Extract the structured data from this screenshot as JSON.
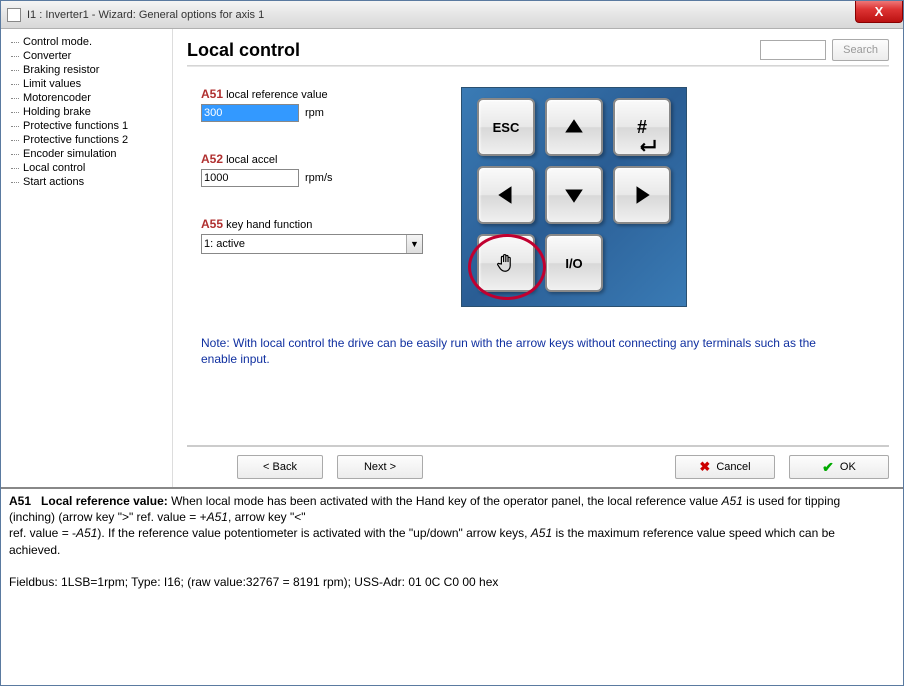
{
  "window": {
    "title": "I1 : Inverter1 - Wizard: General options for axis 1",
    "close": "X"
  },
  "sidebar": {
    "items": [
      "Control mode.",
      "Converter",
      "Braking resistor",
      "Limit values",
      "Motorencoder",
      "Holding brake",
      "Protective functions 1",
      "Protective functions 2",
      "Encoder simulation",
      "Local control",
      "Start actions"
    ]
  },
  "header": {
    "title": "Local control",
    "search_button": "Search"
  },
  "params": {
    "a51": {
      "code": "A51",
      "desc": "local reference value",
      "value": "300",
      "unit": "rpm"
    },
    "a52": {
      "code": "A52",
      "desc": "local accel",
      "value": "1000",
      "unit": "rpm/s"
    },
    "a55": {
      "code": "A55",
      "desc": "key hand function",
      "value": "1: active"
    }
  },
  "keypad": {
    "esc": "ESC",
    "hash": "#",
    "io": "I/O"
  },
  "note": "Note: With local control the drive can be easily run with the arrow keys without connecting any terminals such as the enable input.",
  "nav": {
    "back": "< Back",
    "next": "Next >",
    "cancel": "Cancel",
    "ok": "OK"
  },
  "help": {
    "title_code": "A51",
    "title_text": "Local reference value:",
    "body1a": "When local mode has been activated with the Hand key of the operator panel, the local reference value ",
    "body1_i": "A51",
    "body1b": " is used for tipping (inching) (arrow key \">\" ref. value = +",
    "body1_i2": "A51",
    "body1c": ", arrow key \"<\"",
    "body2a": "ref. value = -",
    "body2_i": "A51",
    "body2b": "). If the reference value potentiometer is activated with the \"up/down\" arrow keys, ",
    "body2_i2": "A51",
    "body2c": " is the maximum reference value speed which can be achieved.",
    "fb": "Fieldbus: 1LSB=1rpm; Type: I16; (raw value:32767 = 8191 rpm); USS-Adr: 01 0C C0 00 hex"
  }
}
